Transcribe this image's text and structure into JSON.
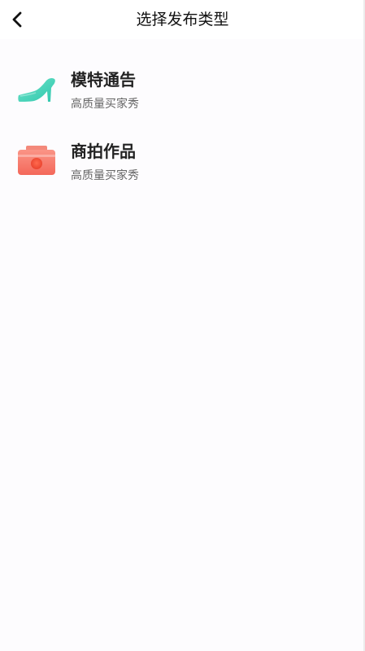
{
  "header": {
    "title": "选择发布类型",
    "back_icon": "chevron-left-icon"
  },
  "items": [
    {
      "title": "模特通告",
      "subtitle": "高质量买家秀",
      "icon": "high-heel-shoe-icon",
      "icon_color": "#3fd3b7"
    },
    {
      "title": "商拍作品",
      "subtitle": "高质量买家秀",
      "icon": "camera-icon",
      "icon_color": "#f77566"
    }
  ],
  "colors": {
    "background": "#fdfcfe",
    "text_primary": "#222222",
    "text_secondary": "#666666"
  }
}
